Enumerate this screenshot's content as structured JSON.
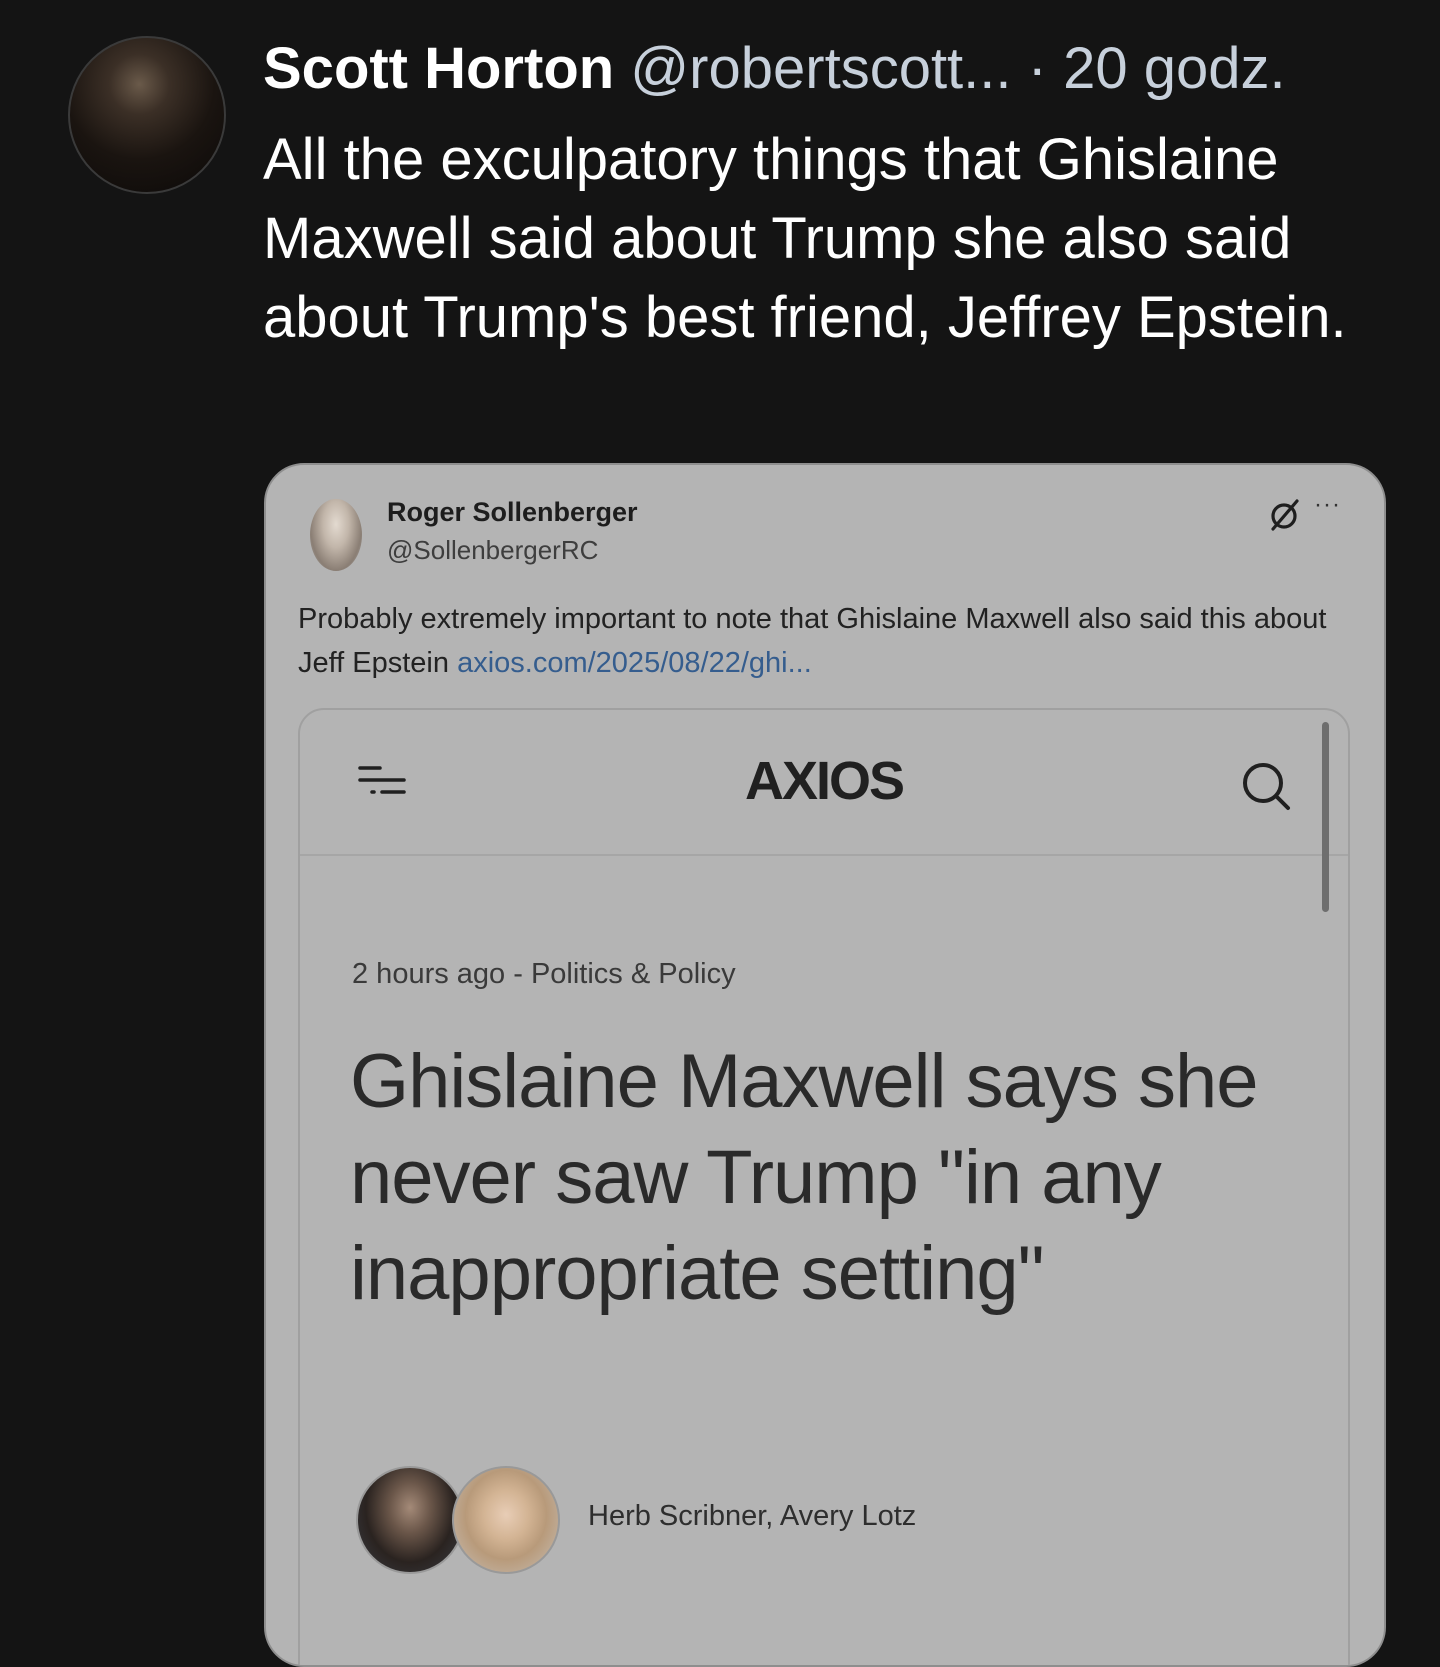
{
  "tweet": {
    "author_name": "Scott Horton",
    "handle": "@robertscott...",
    "separator": "·",
    "time": "20 godz.",
    "text": "All the exculpatory things that Ghislaine Maxwell said about Trump she also said about Trump's best friend, Jeffrey Epstein."
  },
  "quoted": {
    "author_name": "Roger Sollenberger",
    "handle": "@SollenbergerRC",
    "more_label": "···",
    "text": "Probably extremely important to note that Ghislaine Maxwell also said this about Jeff Epstein",
    "link": "axios.com/2025/08/22/ghi...",
    "screenshot": {
      "logo": "AXIOS",
      "meta": "2 hours ago - Politics & Policy",
      "headline": "Ghislaine Maxwell says she never saw Trump \"in any inappropriate setting\"",
      "authors": "Herb Scribner, Avery Lotz"
    }
  },
  "colors": {
    "background": "#141414",
    "card": "#b4b4b4",
    "link": "#355d8e",
    "axios_accent": "#3b6fd4"
  },
  "icons": [
    "menu-icon",
    "search-icon",
    "grok-icon",
    "more-icon"
  ]
}
